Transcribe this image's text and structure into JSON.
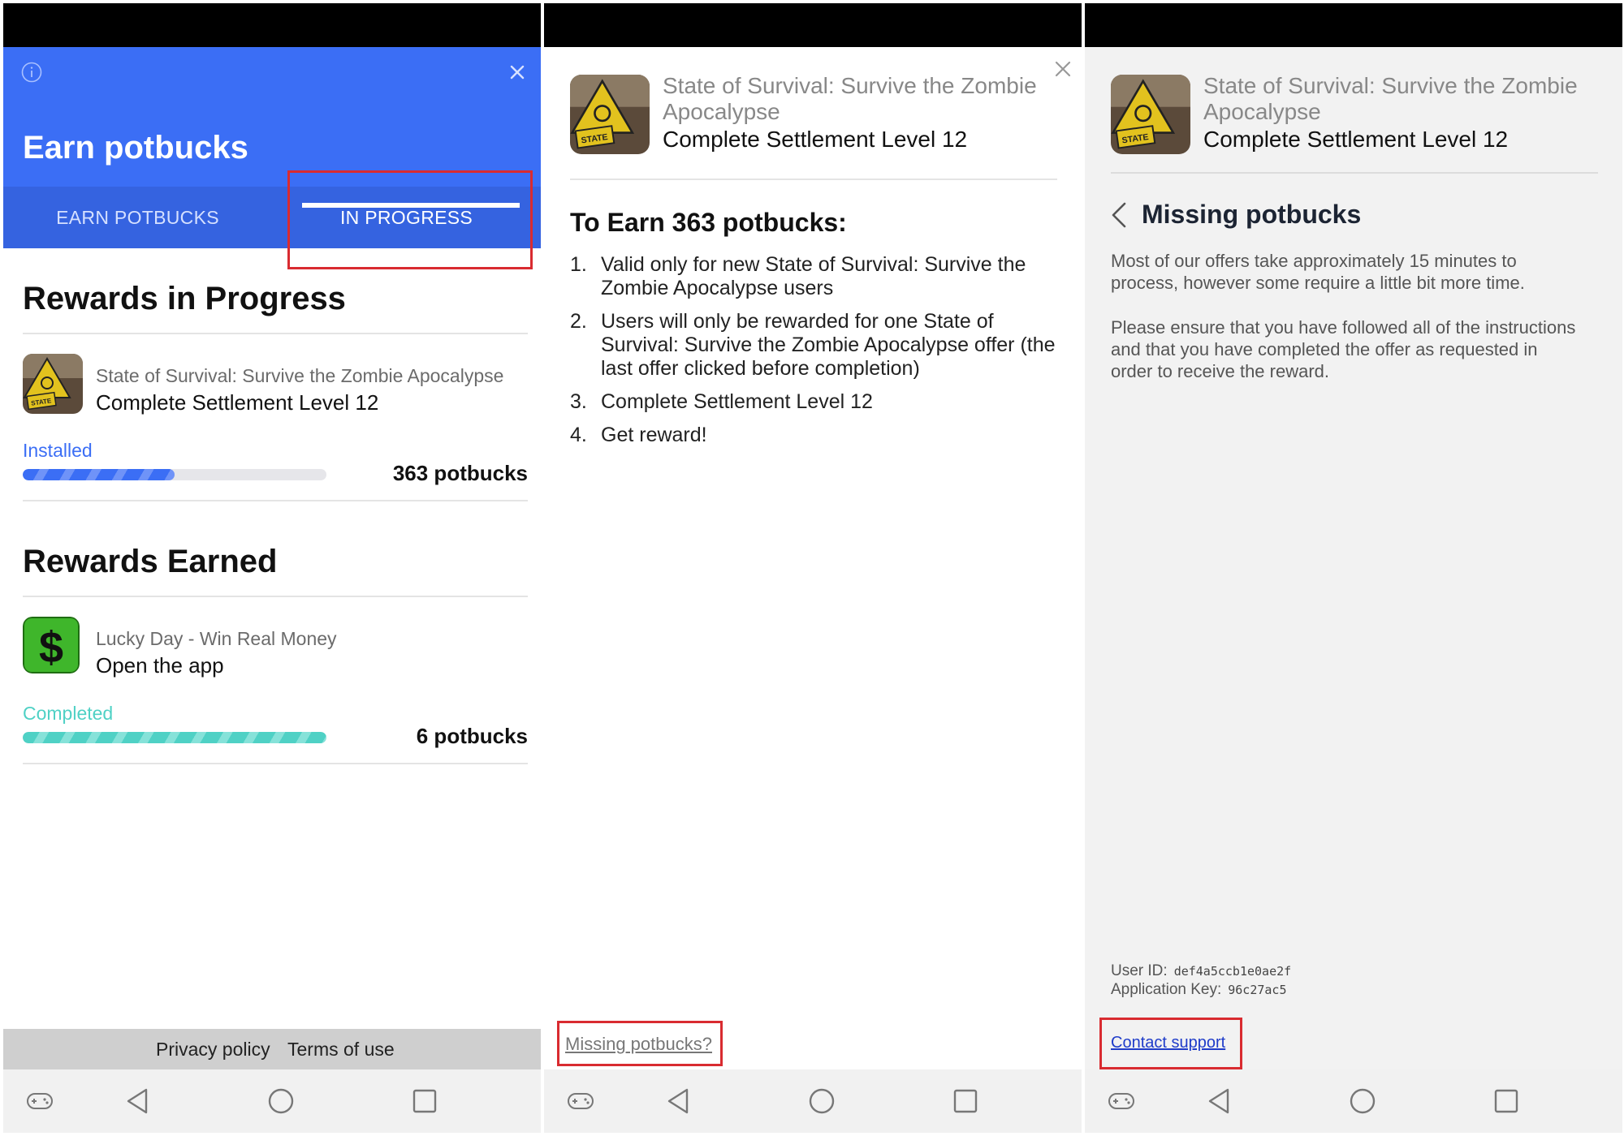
{
  "panel1": {
    "header_title": "Earn potbucks",
    "tabs": [
      {
        "label": "EARN POTBUCKS"
      },
      {
        "label": "IN PROGRESS"
      }
    ],
    "in_progress": {
      "title": "Rewards in Progress",
      "item": {
        "app_name": "State of Survival: Survive the Zombie Apocalypse",
        "task": "Complete Settlement Level 12",
        "status": "Installed",
        "progress": 0.5,
        "reward": "363 potbucks"
      }
    },
    "earned": {
      "title": "Rewards Earned",
      "item": {
        "app_name": "Lucky Day - Win Real Money",
        "task": "Open the app",
        "status": "Completed",
        "progress": 1.0,
        "reward": "6 potbucks"
      }
    },
    "footer": {
      "privacy": "Privacy policy",
      "terms": "Terms of use"
    }
  },
  "panel2": {
    "app_name": "State of Survival: Survive the Zombie Apocalypse",
    "task": "Complete Settlement Level 12",
    "earn_title": "To Earn 363 potbucks:",
    "steps": [
      {
        "num": "1.",
        "text": "Valid only for new State of Survival: Survive the Zombie Apocalypse users"
      },
      {
        "num": "2.",
        "text": "Users will only be rewarded for one State of Survival: Survive the Zombie Apocalypse offer (the last offer clicked before completion)"
      },
      {
        "num": "3.",
        "text": "Complete Settlement Level 12"
      },
      {
        "num": "4.",
        "text": "Get reward!"
      }
    ],
    "missing_link": "Missing potbucks?"
  },
  "panel3": {
    "app_name": "State of Survival: Survive the Zombie Apocalypse",
    "task": "Complete Settlement Level 12",
    "title": "Missing potbucks",
    "para1": "Most of our offers take approximately 15 minutes to process, however some require a little bit more time.",
    "para2": "Please ensure that you have followed all of the instructions and that you have completed the offer as requested in order to receive the reward.",
    "user_id_label": "User ID:",
    "user_id": "def4a5ccb1e0ae2f",
    "app_key_label": "Application Key:",
    "app_key": "96c27ac5",
    "contact": "Contact support"
  },
  "icons": [
    "info-icon",
    "close-icon",
    "back-icon",
    "gamepad-icon",
    "back-triangle-icon",
    "home-circle-icon",
    "recents-square-icon"
  ],
  "colors": {
    "header_blue": "#3b6ef5",
    "tab_blue": "#3563e0",
    "installed_blue": "#3b6ef5",
    "completed_teal": "#4fd1c5",
    "highlight_red": "#d92b30"
  }
}
